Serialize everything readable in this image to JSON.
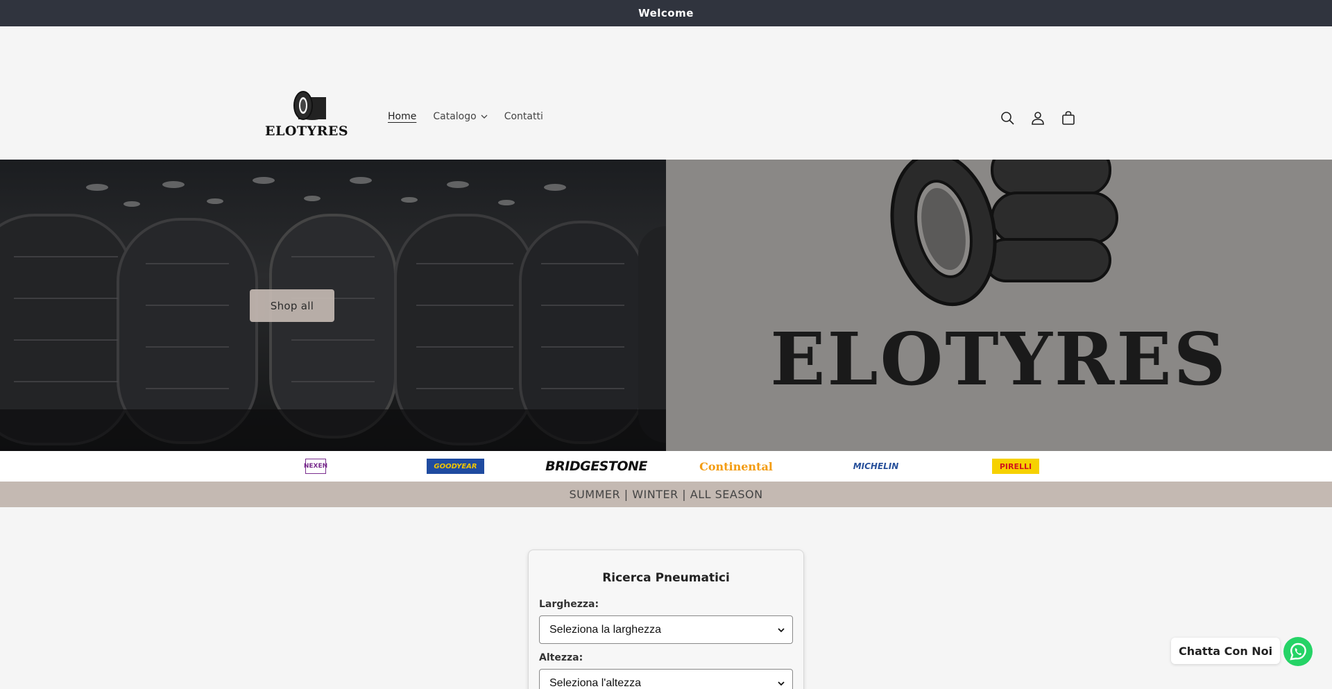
{
  "announcement": {
    "text": "Welcome"
  },
  "header": {
    "logo_text": "ELOTYRES",
    "nav": [
      {
        "label": "Home"
      },
      {
        "label": "Catalogo"
      },
      {
        "label": "Contatti"
      }
    ],
    "icons": [
      "search-icon",
      "account-icon",
      "cart-icon"
    ]
  },
  "hero": {
    "button_label": "Shop all",
    "brand_text": "ELOTYRES"
  },
  "brands": [
    {
      "name": "NEXEN"
    },
    {
      "name": "GOODYEAR"
    },
    {
      "name": "BRIDGESTONE"
    },
    {
      "name": "Continental"
    },
    {
      "name": "MICHELIN"
    },
    {
      "name": "PIRELLI"
    }
  ],
  "season_bar": {
    "text": "SUMMER | WINTER | ALL SEASON"
  },
  "tyre_search": {
    "title": "Ricerca Pneumatici",
    "width_label": "Larghezza:",
    "width_value": "Seleziona la larghezza",
    "height_label": "Altezza:",
    "height_value": "Seleziona l'altezza"
  },
  "chat": {
    "label": "Chatta Con Noi"
  },
  "colors": {
    "announcement_bg": "#30343e",
    "accent": "#c4b9b2",
    "whatsapp": "#25d366",
    "goodyear_bg": "#1f4ba0",
    "goodyear_text": "#f2c500",
    "continental": "#f39c12",
    "michelin": "#27509b",
    "pirelli_bg": "#f6d100",
    "pirelli_text": "#d2151d",
    "nexen": "#7a2e8e"
  }
}
